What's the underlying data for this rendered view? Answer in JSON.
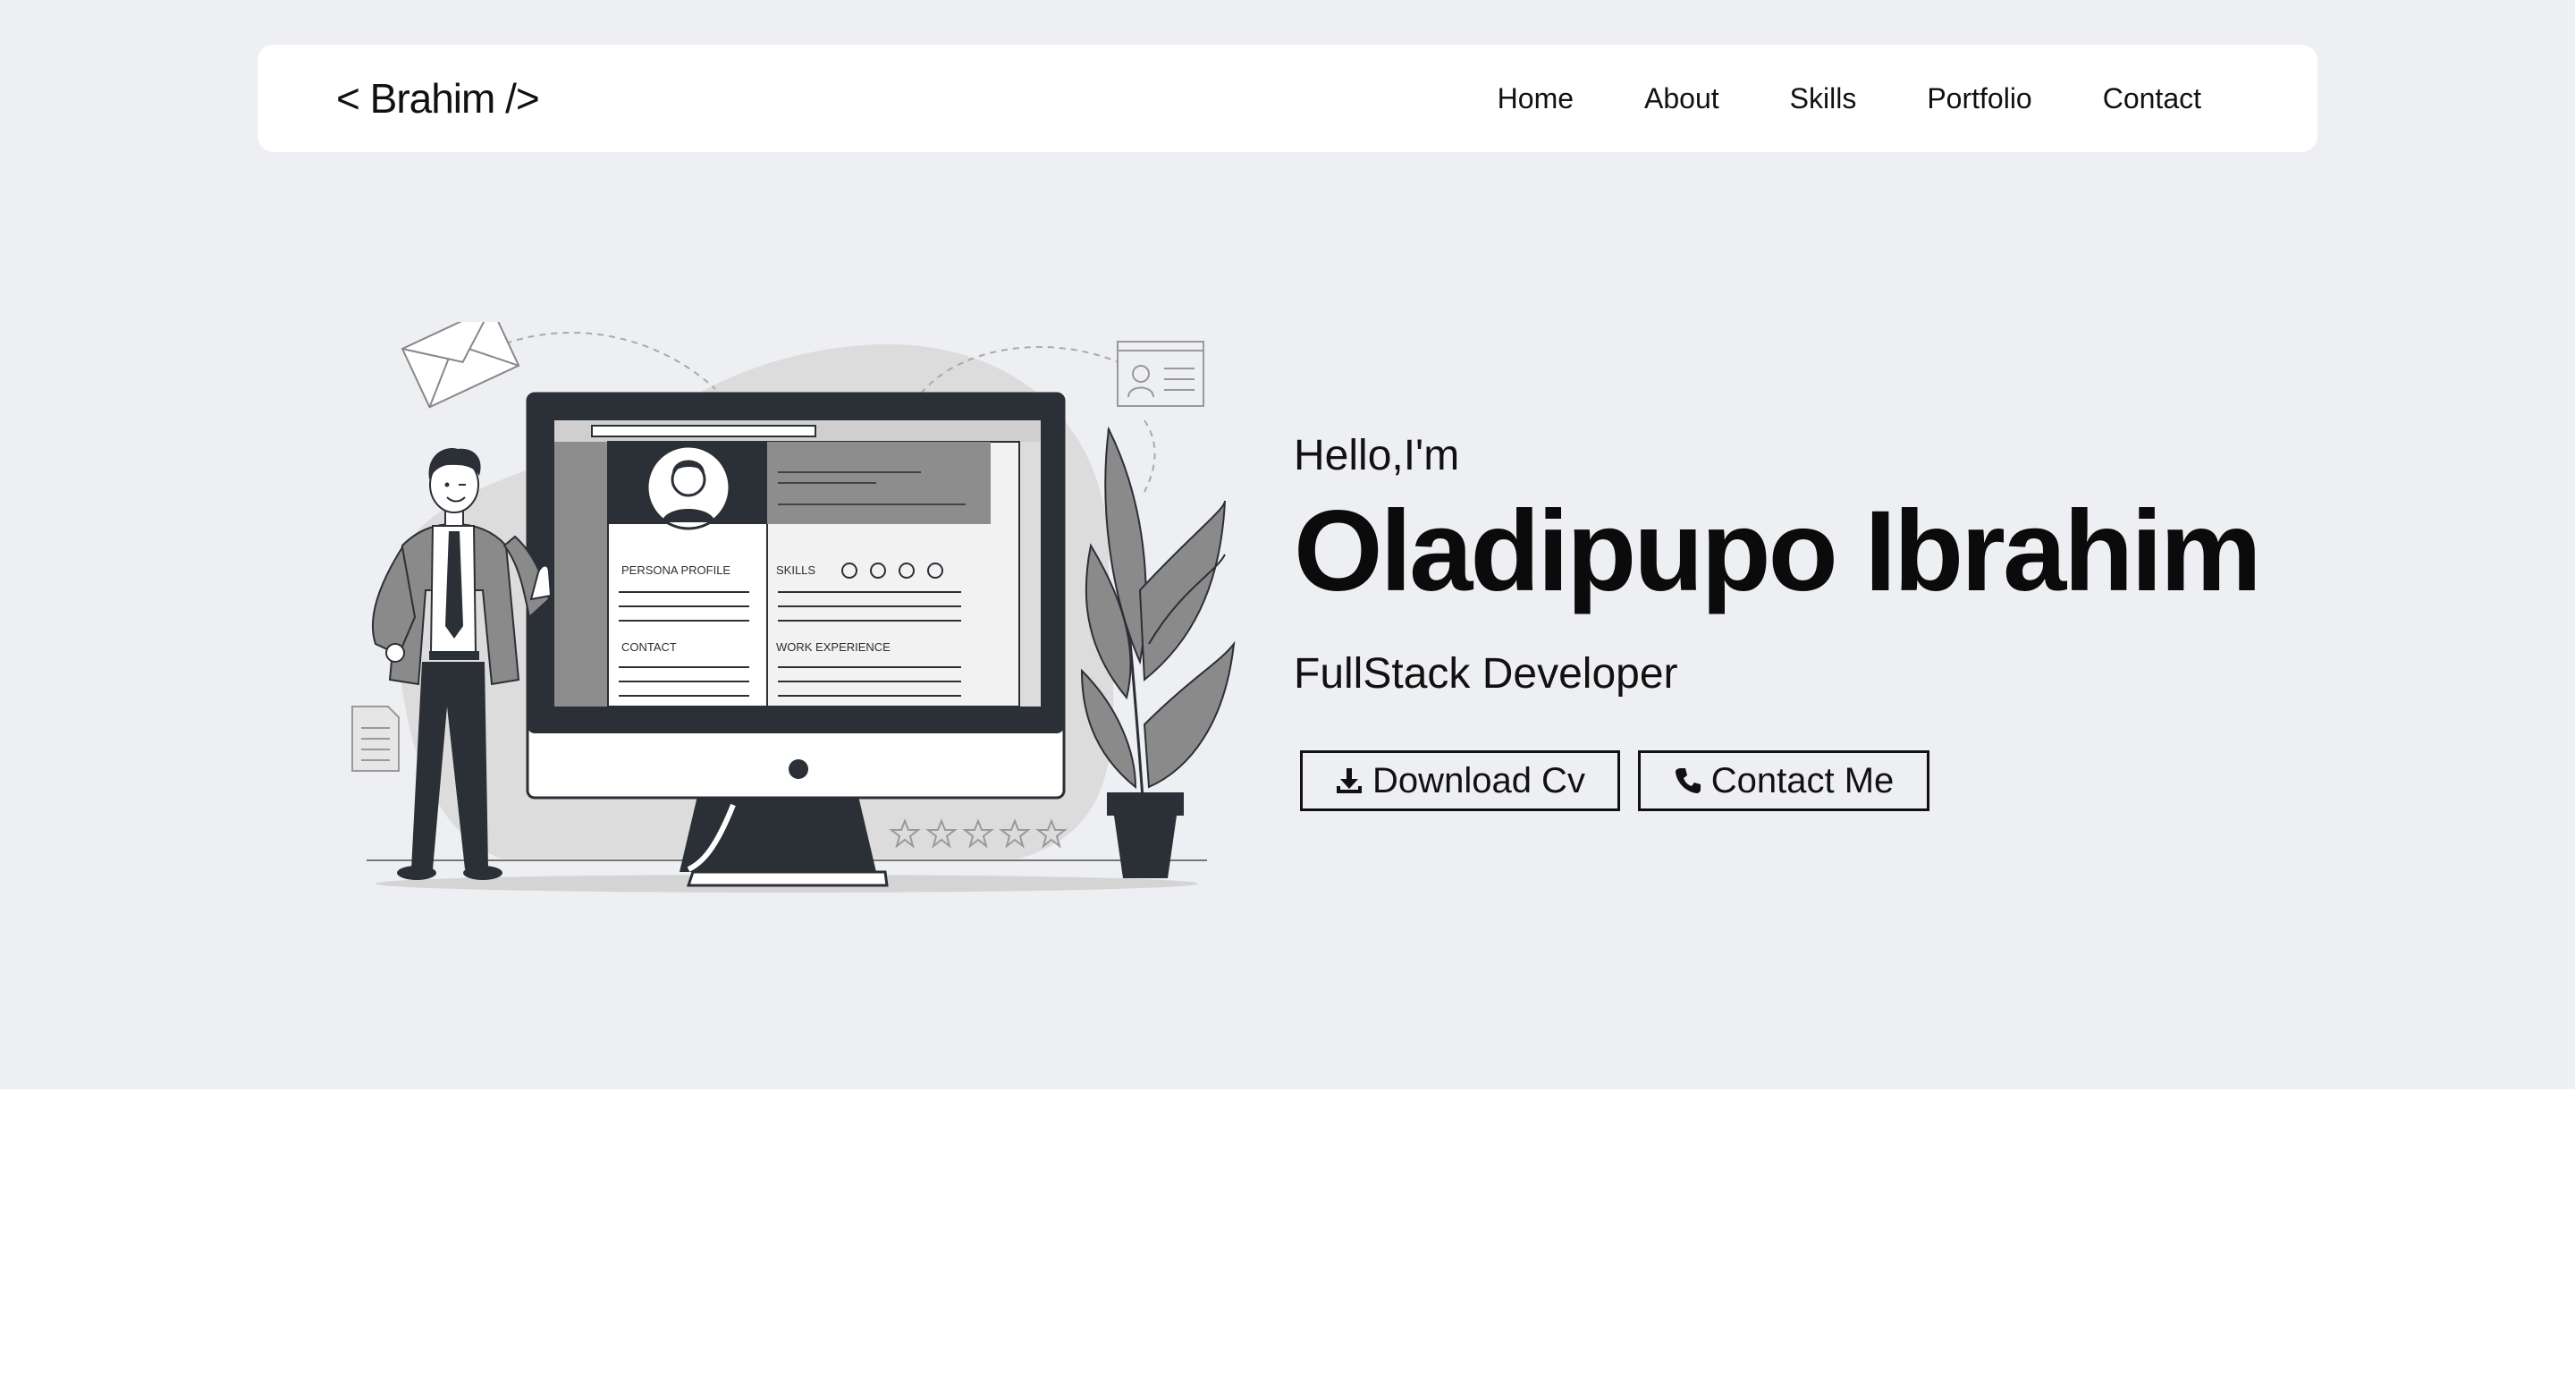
{
  "header": {
    "logo": "< Brahim />",
    "nav": [
      {
        "label": "Home"
      },
      {
        "label": "About"
      },
      {
        "label": "Skills"
      },
      {
        "label": "Portfolio"
      },
      {
        "label": "Contact"
      }
    ]
  },
  "hero": {
    "greeting": "Hello,I'm",
    "name": "Oladipupo Ibrahim",
    "role": "FullStack Developer",
    "buttons": {
      "download": {
        "label": "Download Cv",
        "icon": "download-icon"
      },
      "contact": {
        "label": "Contact Me",
        "icon": "phone-icon"
      }
    }
  },
  "illustration": {
    "cv_labels": {
      "persona_profile": "PERSONA PROFILE",
      "skills": "SKILLS",
      "contact": "CONTACT",
      "work_experience": "WORK EXPERIENCE"
    }
  },
  "colors": {
    "hero_background": "#eeeff2",
    "nav_background": "#ffffff",
    "text": "#111111",
    "illustration_dark": "#2b2f36",
    "illustration_gray": "#8a8a8a"
  }
}
